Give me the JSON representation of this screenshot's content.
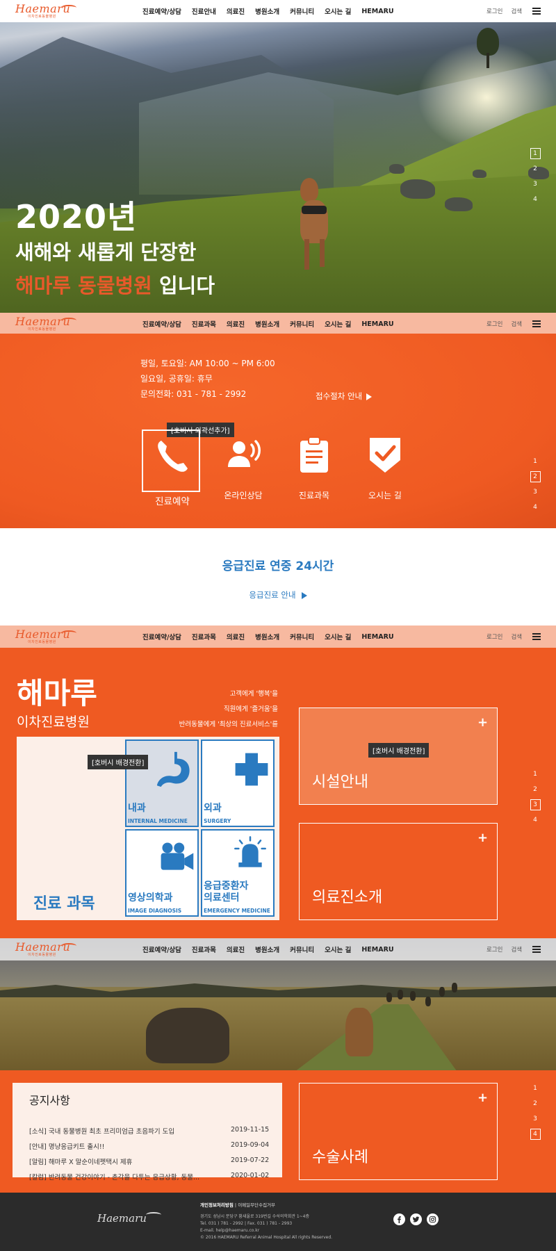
{
  "header": {
    "logo": "Haemaru",
    "logo_sub": "이차진료동물병원",
    "nav_first": [
      "진료예약/상담",
      "진료안내",
      "의료진",
      "병원소개",
      "커뮤니티",
      "오시는 길",
      "HEMARU"
    ],
    "nav_other": [
      "진료예약/상담",
      "진료과목",
      "의료진",
      "병원소개",
      "커뮤니티",
      "오시는 길",
      "HEMARU"
    ],
    "login": "로그인",
    "search": "검색"
  },
  "hero": {
    "line1": "2020년",
    "line2": "새해와 새롭게 단장한",
    "line3_accent": "해마루 동물병원",
    "line3_rest": " 입니다"
  },
  "pager": [
    "1",
    "2",
    "3",
    "4"
  ],
  "info": {
    "hours": "평일, 토요일: AM 10:00 ~ PM 6:00",
    "closed": "일요일, 공휴일: 휴무",
    "phone": "문의전화: 031 - 781 - 2992",
    "reception_link": "접수절차 안내",
    "tooltip": "[호버시 외곽선추가]",
    "quick": [
      {
        "label": "진료예약",
        "icon": "phone-icon"
      },
      {
        "label": "온라인상담",
        "icon": "consult-icon"
      },
      {
        "label": "진료과목",
        "icon": "clipboard-icon"
      },
      {
        "label": "오시는 길",
        "icon": "check-badge-icon"
      }
    ]
  },
  "emergency": {
    "title": "응급진료 연중 24시간",
    "link": "응급진료 안내"
  },
  "departments": {
    "brand": "해마루",
    "brand_sub": "이차진료병원",
    "slogans": [
      "고객에게 '행복'을",
      "직원에게 '즐거움'을",
      "반려동물에게 '최상의 진료서비스'를"
    ],
    "tooltip": "[호버시 배경전환]",
    "title": "진료 과목",
    "cells": [
      {
        "name": "내과",
        "en": "INTERNAL MEDICINE",
        "icon": "stomach-icon"
      },
      {
        "name": "외과",
        "en": "SURGERY",
        "icon": "cross-icon"
      },
      {
        "name": "영상의학과",
        "en": "IMAGE DIAGNOSIS",
        "icon": "camera-icon"
      },
      {
        "name": "응급중환자\n의료센터",
        "en": "EMERGENCY MEDICINE",
        "icon": "siren-icon"
      }
    ],
    "facility": "시설안내",
    "facility_tooltip": "[호버시 배경전환]",
    "staff": "의료진소개",
    "plus": "+"
  },
  "notice": {
    "title": "공지사항",
    "items": [
      {
        "text": "[소식] 국내 동물병원 최초 프리미엄급 초음파기 도입",
        "date": "2019-11-15"
      },
      {
        "text": "[안내] 명냥응급키트 출시!!",
        "date": "2019-09-04"
      },
      {
        "text": "[알림] 해마루 X 말순이네펫택시 제휴",
        "date": "2019-07-22"
      },
      {
        "text": "[칼럼] 반려동물 건강이야기 - 촌각을 다투는 응급상황, 동물...",
        "date": "2020-01-02"
      }
    ],
    "cases": "수술사례"
  },
  "footer": {
    "logo": "Haemaru",
    "privacy": "개인정보처리방침",
    "sep": "|",
    "email_policy": "이메일무단수집거부",
    "address": "경기도 성남시 분당구 황새울로 319번길 수석의학회관 1~4층",
    "tel": "Tel. 031 ) 781 - 2992   |   Fax. 031 ) 781 - 2993",
    "email": "E-mail. help@haemaru.co.kr",
    "copyright": "© 2016 HAEMARU Referral Animal Hospital All rights Reserved.",
    "social": [
      "facebook-icon",
      "twitter-icon",
      "instagram-icon"
    ]
  },
  "colors": {
    "accent": "#ef5a22",
    "blue": "#2a7ac0",
    "peach": "#f7b9a0"
  }
}
